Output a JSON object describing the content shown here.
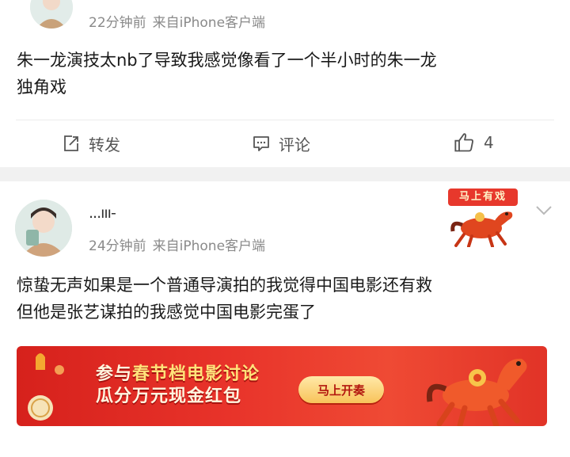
{
  "post1": {
    "meta_time": "22分钟前",
    "meta_source": "来自iPhone客户端",
    "text_line1": "朱一龙演技太nb了导致我感觉像看了一个半小时的朱一龙",
    "text_line2": "独角戏",
    "actions": {
      "repost_label": "转发",
      "comment_label": "评论",
      "like_count": "4"
    }
  },
  "post2": {
    "username": "...ııı-",
    "meta_time": "24分钟前",
    "meta_source": "来自iPhone客户端",
    "badge_text": "马上有戏",
    "text_line1": "惊蛰无声如果是一个普通导演拍的我觉得中国电影还有救",
    "text_line2": "但他是张艺谋拍的我感觉中国电影完蛋了"
  },
  "banner": {
    "line1_prefix": "参与",
    "line1_highlight": "春节档电影讨论",
    "line2": "瓜分万元现金红包",
    "button_label": "马上开奏"
  },
  "colors": {
    "banner_red": "#e8332a",
    "meta_gray": "#8a8a8a",
    "separator": "#f1f1f1"
  }
}
